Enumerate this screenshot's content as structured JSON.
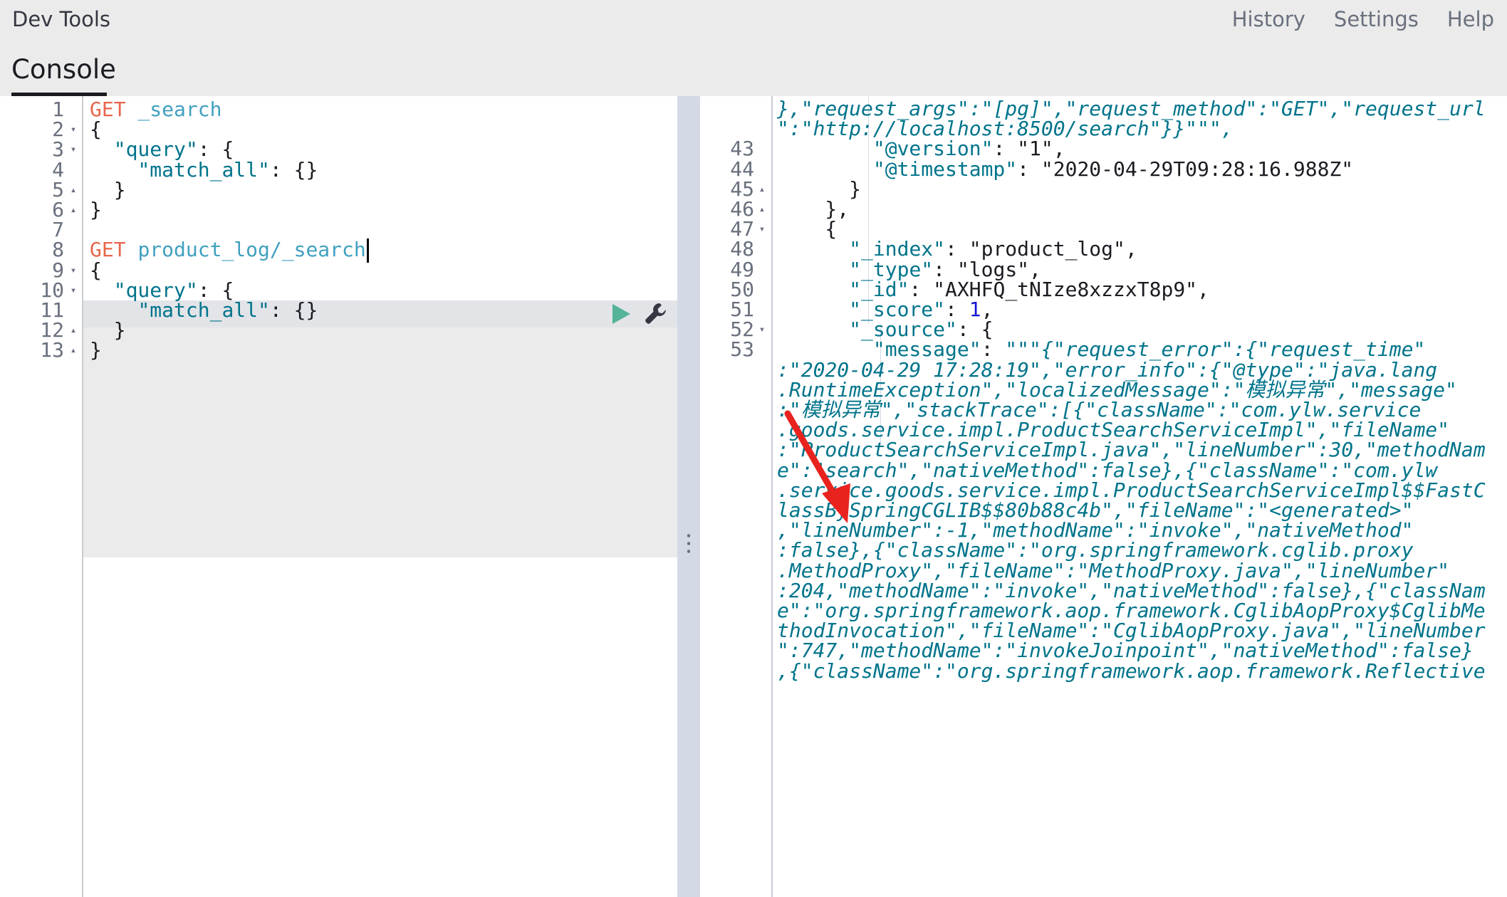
{
  "header": {
    "app_title": "Dev Tools",
    "nav": [
      "History",
      "Settings",
      "Help"
    ],
    "tab": "Console"
  },
  "editor": {
    "lines": [
      {
        "n": "1",
        "fold": "",
        "parts": [
          [
            "kw",
            "GET"
          ],
          [
            "pl",
            " "
          ],
          [
            "url",
            "_search"
          ]
        ]
      },
      {
        "n": "2",
        "fold": "▾",
        "parts": [
          [
            "pl",
            "{"
          ]
        ]
      },
      {
        "n": "3",
        "fold": "▾",
        "parts": [
          [
            "pl",
            "  "
          ],
          [
            "str",
            "\"query\""
          ],
          [
            "pl",
            ": {"
          ]
        ]
      },
      {
        "n": "4",
        "fold": "",
        "parts": [
          [
            "pl",
            "    "
          ],
          [
            "str",
            "\"match_all\""
          ],
          [
            "pl",
            ": {}"
          ]
        ]
      },
      {
        "n": "5",
        "fold": "▴",
        "parts": [
          [
            "pl",
            "  }"
          ]
        ]
      },
      {
        "n": "6",
        "fold": "▴",
        "parts": [
          [
            "pl",
            "}"
          ]
        ]
      },
      {
        "n": "7",
        "fold": "",
        "parts": []
      },
      {
        "n": "8",
        "fold": "",
        "parts": [
          [
            "kw",
            "GET"
          ],
          [
            "pl",
            " "
          ],
          [
            "url",
            "product_log/_search"
          ]
        ],
        "cursor": true
      },
      {
        "n": "9",
        "fold": "▾",
        "parts": [
          [
            "pl",
            "{"
          ]
        ]
      },
      {
        "n": "10",
        "fold": "▾",
        "parts": [
          [
            "pl",
            "  "
          ],
          [
            "str",
            "\"query\""
          ],
          [
            "pl",
            ": {"
          ]
        ]
      },
      {
        "n": "11",
        "fold": "",
        "parts": [
          [
            "pl",
            "    "
          ],
          [
            "str",
            "\"match_all\""
          ],
          [
            "pl",
            ": {}"
          ]
        ]
      },
      {
        "n": "12",
        "fold": "▴",
        "parts": [
          [
            "pl",
            "  }"
          ]
        ]
      },
      {
        "n": "13",
        "fold": "▴",
        "parts": [
          [
            "pl",
            "}"
          ]
        ]
      }
    ]
  },
  "output": {
    "lines": [
      {
        "n": "",
        "fold": "",
        "parts": [
          [
            "wrap",
            "},\"request_args\":\"[pg]\",\"request_method\":\"GET\",\"request_url"
          ]
        ]
      },
      {
        "n": "",
        "fold": "",
        "parts": [
          [
            "wrap",
            "\":\"http://localhost:8500/search\"}}\"\"\","
          ]
        ]
      },
      {
        "n": "43",
        "fold": "",
        "parts": [
          [
            "pl",
            "        "
          ],
          [
            "str",
            "\"@version\""
          ],
          [
            "pl",
            ": "
          ],
          [
            "pl",
            "\"1\""
          ],
          [
            "pl",
            ","
          ]
        ]
      },
      {
        "n": "44",
        "fold": "",
        "parts": [
          [
            "pl",
            "        "
          ],
          [
            "str",
            "\"@timestamp\""
          ],
          [
            "pl",
            ": "
          ],
          [
            "pl",
            "\"2020-04-29T09:28:16.988Z\""
          ]
        ]
      },
      {
        "n": "45",
        "fold": "▴",
        "parts": [
          [
            "pl",
            "      }"
          ]
        ]
      },
      {
        "n": "46",
        "fold": "▴",
        "parts": [
          [
            "pl",
            "    },"
          ]
        ]
      },
      {
        "n": "47",
        "fold": "▾",
        "parts": [
          [
            "pl",
            "    {"
          ]
        ]
      },
      {
        "n": "48",
        "fold": "",
        "parts": [
          [
            "pl",
            "      "
          ],
          [
            "str",
            "\"_index\""
          ],
          [
            "pl",
            ": "
          ],
          [
            "pl",
            "\"product_log\""
          ],
          [
            "pl",
            ","
          ]
        ]
      },
      {
        "n": "49",
        "fold": "",
        "parts": [
          [
            "pl",
            "      "
          ],
          [
            "str",
            "\"_type\""
          ],
          [
            "pl",
            ": "
          ],
          [
            "pl",
            "\"logs\""
          ],
          [
            "pl",
            ","
          ]
        ]
      },
      {
        "n": "50",
        "fold": "",
        "parts": [
          [
            "pl",
            "      "
          ],
          [
            "str",
            "\"_id\""
          ],
          [
            "pl",
            ": "
          ],
          [
            "pl",
            "\"AXHFQ_tNIze8xzzxT8p9\""
          ],
          [
            "pl",
            ","
          ]
        ]
      },
      {
        "n": "51",
        "fold": "",
        "parts": [
          [
            "pl",
            "      "
          ],
          [
            "str",
            "\"_score\""
          ],
          [
            "pl",
            ": "
          ],
          [
            "num",
            "1"
          ],
          [
            "pl",
            ","
          ]
        ]
      },
      {
        "n": "52",
        "fold": "▾",
        "parts": [
          [
            "pl",
            "      "
          ],
          [
            "str",
            "\"_source\""
          ],
          [
            "pl",
            ": {"
          ]
        ]
      },
      {
        "n": "53",
        "fold": "",
        "parts": [
          [
            "pl",
            "        "
          ],
          [
            "str",
            "\"message\""
          ],
          [
            "pl",
            ": "
          ],
          [
            "wrap",
            "\"\"\"{\"request_error\":{\"request_time\""
          ]
        ]
      },
      {
        "n": "",
        "fold": "",
        "parts": [
          [
            "wrap",
            ":\"2020-04-29 17:28:19\",\"error_info\":{\"@type\":\"java.lang"
          ]
        ]
      },
      {
        "n": "",
        "fold": "",
        "parts": [
          [
            "wrap",
            ".RuntimeException\",\"localizedMessage\":\"模拟异常\",\"message\""
          ]
        ]
      },
      {
        "n": "",
        "fold": "",
        "parts": [
          [
            "wrap",
            ":\"模拟异常\",\"stackTrace\":[{\"className\":\"com.ylw.service"
          ]
        ]
      },
      {
        "n": "",
        "fold": "",
        "parts": [
          [
            "wrap",
            ".goods.service.impl.ProductSearchServiceImpl\",\"fileName\""
          ]
        ]
      },
      {
        "n": "",
        "fold": "",
        "parts": [
          [
            "wrap",
            ":\"ProductSearchServiceImpl.java\",\"lineNumber\":30,\"methodNam"
          ]
        ]
      },
      {
        "n": "",
        "fold": "",
        "parts": [
          [
            "wrap",
            "e\":\"search\",\"nativeMethod\":false},{\"className\":\"com.ylw"
          ]
        ]
      },
      {
        "n": "",
        "fold": "",
        "parts": [
          [
            "wrap",
            ".service.goods.service.impl.ProductSearchServiceImpl$$FastC"
          ]
        ]
      },
      {
        "n": "",
        "fold": "",
        "parts": [
          [
            "wrap",
            "lassBySpringCGLIB$$80b88c4b\",\"fileName\":\"<generated>\""
          ]
        ]
      },
      {
        "n": "",
        "fold": "",
        "parts": [
          [
            "wrap",
            ",\"lineNumber\":-1,\"methodName\":\"invoke\",\"nativeMethod\""
          ]
        ]
      },
      {
        "n": "",
        "fold": "",
        "parts": [
          [
            "wrap",
            ":false},{\"className\":\"org.springframework.cglib.proxy"
          ]
        ]
      },
      {
        "n": "",
        "fold": "",
        "parts": [
          [
            "wrap",
            ".MethodProxy\",\"fileName\":\"MethodProxy.java\",\"lineNumber\""
          ]
        ]
      },
      {
        "n": "",
        "fold": "",
        "parts": [
          [
            "wrap",
            ":204,\"methodName\":\"invoke\",\"nativeMethod\":false},{\"classNam"
          ]
        ]
      },
      {
        "n": "",
        "fold": "",
        "parts": [
          [
            "wrap",
            "e\":\"org.springframework.aop.framework.CglibAopProxy$CglibMe"
          ]
        ]
      },
      {
        "n": "",
        "fold": "",
        "parts": [
          [
            "wrap",
            "thodInvocation\",\"fileName\":\"CglibAopProxy.java\",\"lineNumber"
          ]
        ]
      },
      {
        "n": "",
        "fold": "",
        "parts": [
          [
            "wrap",
            "\":747,\"methodName\":\"invokeJoinpoint\",\"nativeMethod\":false}"
          ]
        ]
      },
      {
        "n": "",
        "fold": "",
        "parts": [
          [
            "wrap",
            ",{\"className\":\"org.springframework.aop.framework.Reflective"
          ]
        ]
      }
    ]
  },
  "colors": {
    "keyword": "#e7664c",
    "url": "#40a0c0",
    "string": "#00748b",
    "arrow": "#e8231e"
  }
}
